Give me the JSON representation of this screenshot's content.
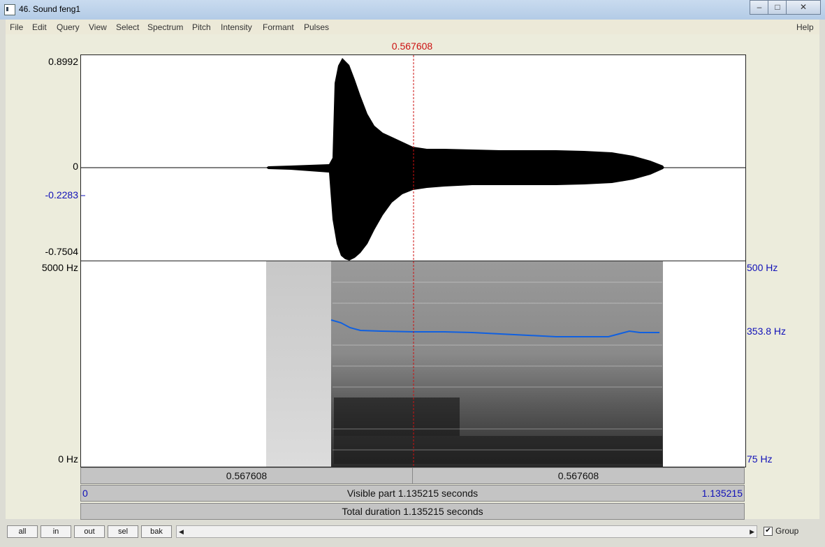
{
  "window": {
    "title": "46. Sound feng1",
    "controls": [
      "minimize-icon",
      "maximize-icon",
      "close-icon"
    ]
  },
  "menu": {
    "items": [
      "File",
      "Edit",
      "Query",
      "View",
      "Select",
      "Spectrum",
      "Pitch",
      "Intensity",
      "Formant",
      "Pulses"
    ],
    "help": "Help"
  },
  "cursor": {
    "time": "0.567608"
  },
  "waveform": {
    "max_label": "0.8992",
    "zero_label": "0",
    "level_label": "-0.2283",
    "min_label": "-0.7504"
  },
  "spectrogram": {
    "top_freq": "5000 Hz",
    "bottom_freq": "0 Hz",
    "pitch_top": "500 Hz",
    "pitch_value": "353.8 Hz",
    "pitch_bottom": "75 Hz"
  },
  "bars": {
    "left_segment": "0.567608",
    "right_segment": "0.567608",
    "visible_start": "0",
    "visible_part": "Visible part 1.135215 seconds",
    "visible_end": "1.135215",
    "total": "Total duration 1.135215 seconds"
  },
  "buttons": {
    "all": "all",
    "in": "in",
    "out": "out",
    "sel": "sel",
    "bak": "bak"
  },
  "group": {
    "label": "Group",
    "checked": "✔"
  },
  "colors": {
    "cursor": "#cc1010",
    "pitch": "#1060e0",
    "axis_blue": "#1010b8"
  }
}
